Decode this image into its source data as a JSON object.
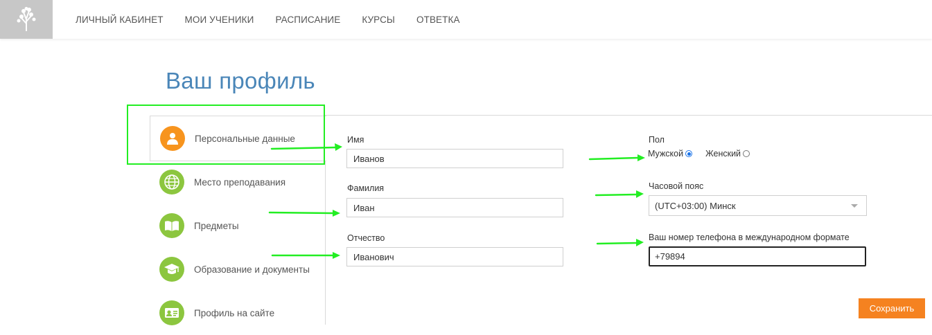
{
  "nav": {
    "items": [
      "ЛИЧНЫЙ КАБИНЕТ",
      "МОИ УЧЕНИКИ",
      "РАСПИСАНИЕ",
      "КУРСЫ",
      "ОТВЕТКА"
    ]
  },
  "page": {
    "title": "Ваш профиль"
  },
  "sidebar": {
    "items": [
      {
        "label": "Персональные данные",
        "icon": "user-icon",
        "active": true
      },
      {
        "label": "Место преподавания",
        "icon": "globe-icon",
        "active": false
      },
      {
        "label": "Предметы",
        "icon": "book-icon",
        "active": false
      },
      {
        "label": "Образование и документы",
        "icon": "graduation-cap-icon",
        "active": false
      },
      {
        "label": "Профиль на сайте",
        "icon": "id-card-icon",
        "active": false
      }
    ]
  },
  "form": {
    "first_name": {
      "label": "Имя",
      "value": "Иванов"
    },
    "last_name": {
      "label": "Фамилия",
      "value": "Иван"
    },
    "patronymic": {
      "label": "Отчество",
      "value": "Иванович"
    },
    "gender": {
      "label": "Пол",
      "male": "Мужской",
      "female": "Женский",
      "selected": "male"
    },
    "timezone": {
      "label": "Часовой пояс",
      "value": "(UTC+03:00) Минск"
    },
    "phone": {
      "label": "Ваш номер телефона в международном формате",
      "value": "+79894"
    }
  },
  "actions": {
    "save_label": "Сохранить"
  },
  "colors": {
    "accent_orange": "#f58220",
    "icon_green": "#8cc63f",
    "title_blue": "#4a86b8",
    "annotation_green": "#22ee22",
    "radio_blue": "#1a73e8"
  }
}
